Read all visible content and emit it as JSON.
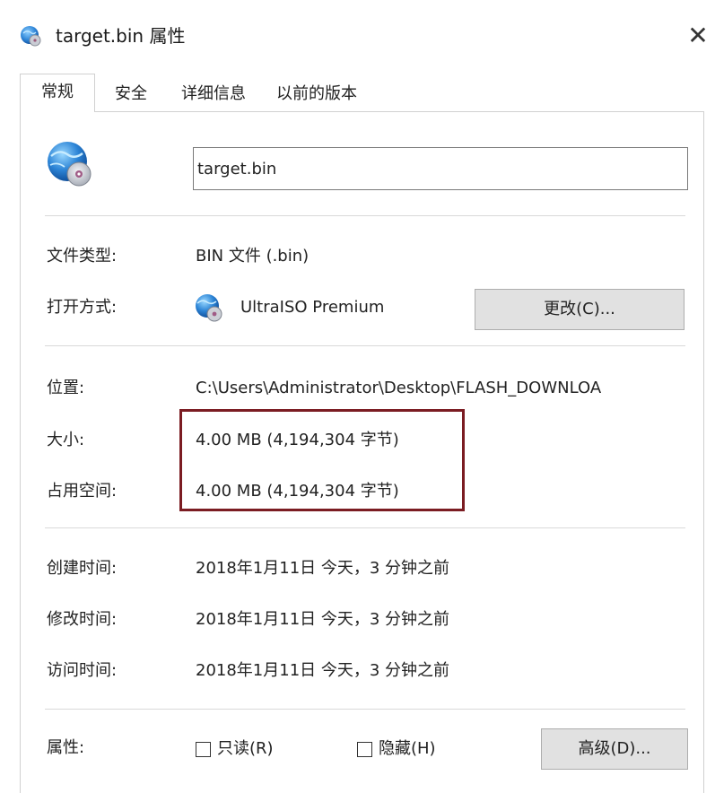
{
  "window": {
    "title": "target.bin 属性",
    "close_label": "✕"
  },
  "tabs": [
    {
      "label": "常规",
      "active": true
    },
    {
      "label": "安全"
    },
    {
      "label": "详细信息"
    },
    {
      "label": "以前的版本"
    }
  ],
  "general": {
    "file_name": "target.bin",
    "file_type_label": "文件类型:",
    "file_type_value": "BIN 文件 (.bin)",
    "opens_with_label": "打开方式:",
    "opens_with_value": "UltraISO Premium",
    "change_button": "更改(C)...",
    "location_label": "位置:",
    "location_value": "C:\\Users\\Administrator\\Desktop\\FLASH_DOWNLOA",
    "size_label": "大小:",
    "size_value": "4.00 MB (4,194,304 字节)",
    "size_on_disk_label": "占用空间:",
    "size_on_disk_value": "4.00 MB (4,194,304 字节)",
    "created_label": "创建时间:",
    "created_value": "2018年1月11日 今天，3 分钟之前",
    "modified_label": "修改时间:",
    "modified_value": "2018年1月11日 今天，3 分钟之前",
    "accessed_label": "访问时间:",
    "accessed_value": "2018年1月11日 今天，3 分钟之前",
    "attributes_label": "属性:",
    "readonly_label": "只读(R)",
    "readonly_checked": false,
    "hidden_label": "隐藏(H)",
    "hidden_checked": false,
    "advanced_button": "高级(D)..."
  },
  "colors": {
    "highlight_border": "#7b1c22",
    "button_bg": "#e1e1e1",
    "separator": "#d9d9d9"
  },
  "icons": {
    "title": "disc-globe-icon",
    "file": "disc-globe-icon",
    "app": "ultraiso-icon"
  }
}
